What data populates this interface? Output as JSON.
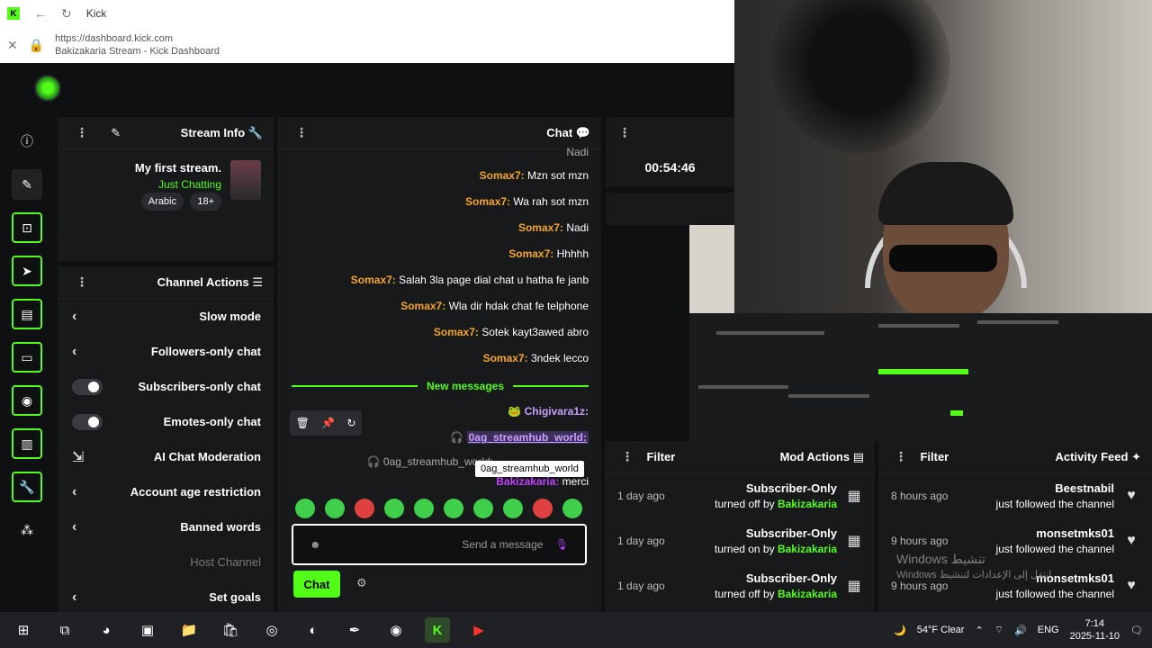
{
  "browser": {
    "tab_title": "Kick",
    "url": "https://dashboard.kick.com",
    "page_title": "Bakizakaria Stream - Kick Dashboard"
  },
  "stream_info": {
    "header": "Stream Info",
    "title": "My first stream.",
    "category": "Just Chatting",
    "tags": [
      "18+",
      "Arabic"
    ]
  },
  "channel_actions": {
    "header": "Channel Actions",
    "items": [
      {
        "label": "Slow mode",
        "control": "chevron"
      },
      {
        "label": "Followers-only chat",
        "control": "chevron"
      },
      {
        "label": "Subscribers-only chat",
        "control": "toggle"
      },
      {
        "label": "Emotes-only chat",
        "control": "toggle"
      },
      {
        "label": "AI Chat Moderation",
        "control": "external"
      },
      {
        "label": "Account age restriction",
        "control": "chevron"
      },
      {
        "label": "Banned words",
        "control": "chevron"
      },
      {
        "label": "Host Channel",
        "control": "none"
      },
      {
        "label": "Set goals",
        "control": "chevron"
      }
    ]
  },
  "chat": {
    "header": "Chat",
    "partial_top": "Nadi",
    "messages": [
      {
        "user": "Somax7:",
        "text": "Mzn sot mzn"
      },
      {
        "user": "Somax7:",
        "text": "Wa rah sot mzn"
      },
      {
        "user": "Somax7:",
        "text": "Nadi"
      },
      {
        "user": "Somax7:",
        "text": "Hhhhh"
      },
      {
        "user": "Somax7:",
        "text": "Salah 3la page dial chat u hatha fe janb"
      },
      {
        "user": "Somax7:",
        "text": "Wla dir hdak chat fe telphone"
      },
      {
        "user": "Somax7:",
        "text": "Sotek kayt3awed abro"
      },
      {
        "user": "Somax7:",
        "text": "3ndek lecco"
      }
    ],
    "new_messages_label": "New messages",
    "msg_chigi_user": "Chigivara1z:",
    "msg_highlight_user": "0ag_streamhub_world:",
    "msg_small_user": "0ag_streamhub_world:",
    "msg_merci_user": "Bakizakaria:",
    "msg_merci_text": "merci",
    "tooltip": "0ag_streamhub_world",
    "input_placeholder": "Send a message",
    "send_label": "Chat"
  },
  "timer": "00:54:46",
  "mod_actions": {
    "header": "Mod Actions",
    "filter": "Filter",
    "items": [
      {
        "title": "Subscriber-Only",
        "action": "turned off by ",
        "actor": "Bakizakaria",
        "time": "1 day ago"
      },
      {
        "title": "Subscriber-Only",
        "action": "turned on by ",
        "actor": "Bakizakaria",
        "time": "1 day ago"
      },
      {
        "title": "Subscriber-Only",
        "action": "turned off by ",
        "actor": "Bakizakaria",
        "time": "1 day ago"
      }
    ]
  },
  "activity_feed": {
    "header": "Activity Feed",
    "filter": "Filter",
    "items": [
      {
        "user": "Beestnabil",
        "text": "just followed the channel",
        "time": "8 hours ago"
      },
      {
        "user": "monsetmks01",
        "text": "just followed the channel",
        "time": "9 hours ago"
      },
      {
        "user": "monsetmks01",
        "text": "just followed the channel",
        "time": "9 hours ago"
      }
    ]
  },
  "watermark": {
    "line1": "Windows تنشيط",
    "line2": "Windows انتقل إلى الإعدادات لتنشيط"
  },
  "taskbar": {
    "weather": "54°F  Clear",
    "lang": "ENG",
    "time": "7:14",
    "date": "2025-11-10"
  },
  "colors": {
    "accent": "#53fc18",
    "panel": "#18191b",
    "bg": "#0f1011",
    "username": "#f5a623"
  }
}
